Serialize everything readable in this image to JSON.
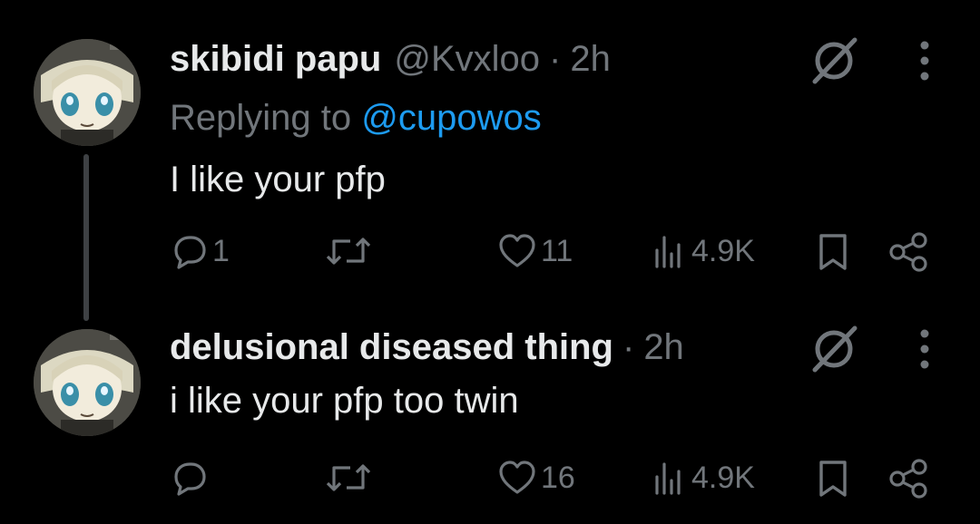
{
  "tweets": [
    {
      "name": "skibidi papu",
      "handle": "@Kvxloo",
      "separator": "·",
      "time": "2h",
      "replying_prefix": "Replying to ",
      "replying_mention": "@cupowos",
      "text": "I like your pfp",
      "stats": {
        "replies": "1",
        "reposts": "",
        "likes": "11",
        "views": "4.9K"
      }
    },
    {
      "name": "delusional diseased thing",
      "separator": "·",
      "time": "2h",
      "text": "i like your pfp too twin",
      "stats": {
        "replies": "",
        "reposts": "",
        "likes": "16",
        "views": "4.9K"
      }
    }
  ],
  "icons": {
    "reply": "reply-icon",
    "repost": "repost-icon",
    "like": "heart-icon",
    "views": "views-icon",
    "bookmark": "bookmark-icon",
    "share": "share-icon",
    "grok": "grok-icon",
    "more": "more-icon"
  },
  "colors": {
    "background": "#000000",
    "text": "#e7e9ea",
    "secondary": "#71767b",
    "link": "#1d9bf0",
    "thread_line": "#3e4144"
  }
}
